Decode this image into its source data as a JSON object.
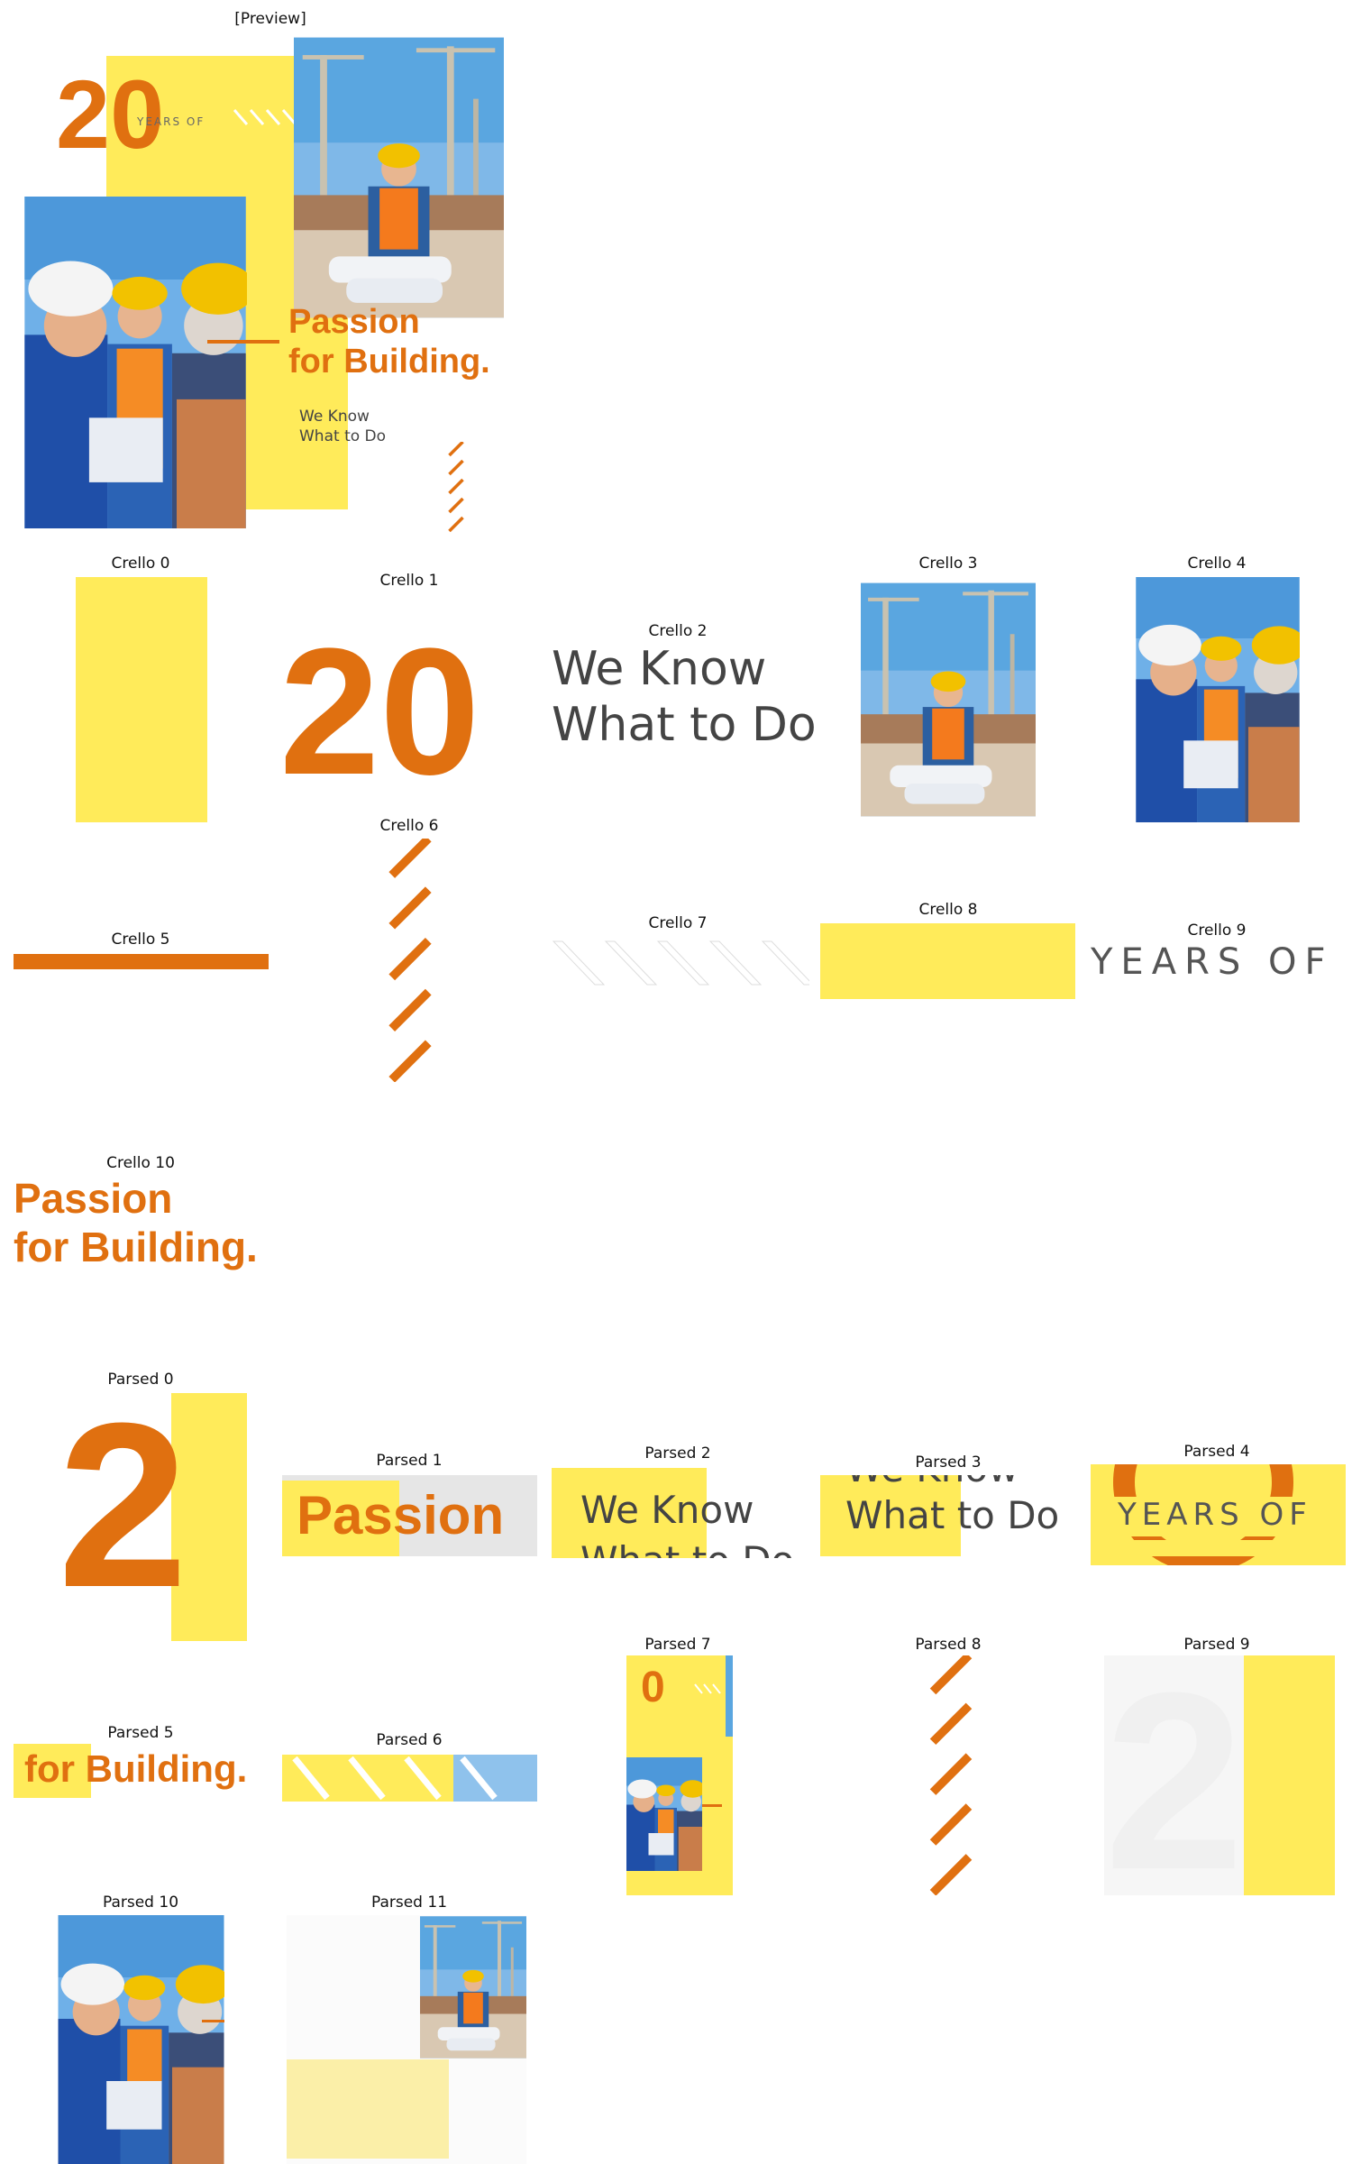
{
  "preview_label": "[Preview]",
  "poster": {
    "big_number": "20",
    "years_of": "YEARS OF",
    "title_line1": "Passion",
    "title_line2": "for Building.",
    "sub_line1": "We Know",
    "sub_line2": "What to Do"
  },
  "crello": {
    "labels": [
      "Crello 0",
      "Crello 1",
      "Crello 2",
      "Crello 3",
      "Crello 4",
      "Crello 5",
      "Crello 6",
      "Crello 7",
      "Crello 8",
      "Crello 9",
      "Crello 10"
    ],
    "number": "20",
    "we_know_line1": "We Know",
    "we_know_line2": "What to Do",
    "years_of": "YEARS OF",
    "passion_line1": "Passion",
    "passion_line2": "for Building."
  },
  "parsed": {
    "labels": [
      "Parsed 0",
      "Parsed 1",
      "Parsed 2",
      "Parsed 3",
      "Parsed 4",
      "Parsed 5",
      "Parsed 6",
      "Parsed 7",
      "Parsed 8",
      "Parsed 9",
      "Parsed 10",
      "Parsed 11"
    ],
    "p0_text": "2",
    "p1_text": "Passion",
    "p2_line1": "We Know",
    "p2_line2": "What to Do",
    "p3_line1": "We Know",
    "p3_line2": "What to Do",
    "p4_text": "YEARS OF",
    "p5_text": "for Building.",
    "p7_text": "0",
    "p9_text": "2"
  },
  "colors": {
    "yellow": "#ffeb5a",
    "orange": "#e07010",
    "sky": "#5aa6e0",
    "text_gray": "#444444"
  }
}
